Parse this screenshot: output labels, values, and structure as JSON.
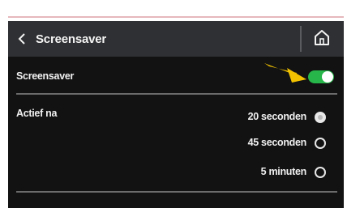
{
  "header": {
    "title": "Screensaver",
    "back_icon": "chevron-left-icon",
    "home_icon": "home-icon"
  },
  "screensaver_row": {
    "label": "Screensaver",
    "toggle_on": true,
    "toggle_color": "#27b64a"
  },
  "active_after": {
    "label": "Actief na",
    "options": [
      {
        "label": "20 seconden",
        "selected": true
      },
      {
        "label": "45 seconden",
        "selected": false
      },
      {
        "label": "5 minuten",
        "selected": false
      }
    ]
  },
  "annotation": {
    "arrow_color": "#f2c200"
  }
}
